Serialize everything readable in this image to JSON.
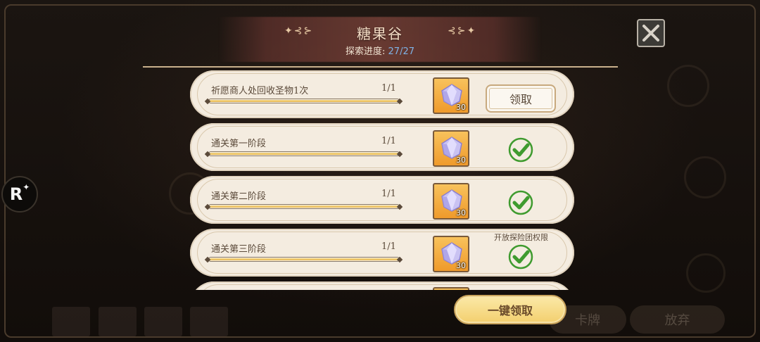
{
  "header": {
    "title": "糖果谷",
    "progress_label": "探索进度:",
    "progress_value": "27/27",
    "ornament_left": "✦⊰⊱",
    "ornament_right": "⊰⊱✦"
  },
  "side": {
    "r_label": "R"
  },
  "tasks": [
    {
      "title": "祈愿商人处回收圣物1次",
      "count": "1/1",
      "progress": 1.0,
      "reward_qty": "30",
      "status": "claimable",
      "claim_label": "领取",
      "note": ""
    },
    {
      "title": "通关第一阶段",
      "count": "1/1",
      "progress": 1.0,
      "reward_qty": "30",
      "status": "claimed",
      "note": ""
    },
    {
      "title": "通关第二阶段",
      "count": "1/1",
      "progress": 1.0,
      "reward_qty": "30",
      "status": "claimed",
      "note": ""
    },
    {
      "title": "通关第三阶段",
      "count": "1/1",
      "progress": 1.0,
      "reward_qty": "30",
      "status": "claimed",
      "note": "开放探险团权限"
    }
  ],
  "footer": {
    "claim_all_label": "一键领取"
  },
  "background": {
    "btn_card": "卡牌",
    "btn_abandon": "放弃"
  },
  "icons": {
    "close": "close-icon",
    "check": "check-icon",
    "gem": "crystal-gem-icon"
  },
  "colors": {
    "progress_value": "#7fb3e6",
    "bar_fill": "#e6b44c",
    "reward_bg": "#f3a83a",
    "check_green": "#3f9b2f"
  }
}
